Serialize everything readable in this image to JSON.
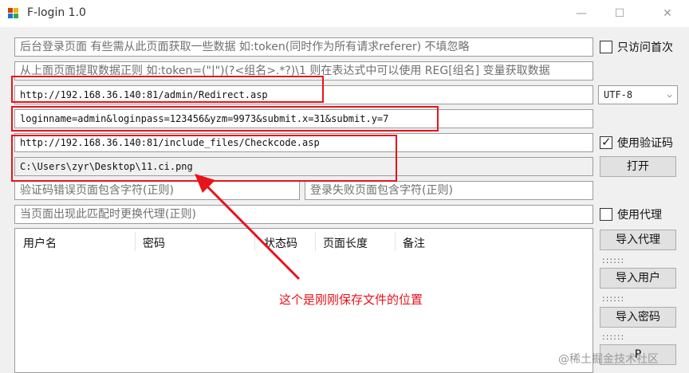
{
  "window": {
    "title": "F-login 1.0",
    "controls": {
      "minimize": "—",
      "maximize": "☐",
      "close": "✕"
    }
  },
  "form": {
    "admin_page_placeholder": "后台登录页面 有些需从此页面获取一些数据 如:token(同时作为所有请求referer) 不填忽略",
    "regex_placeholder": "从上面页面提取数据正则 如:token=(\"|\")(?<组名>.*?)\\1 则在表达式中可以使用 REG[组名] 变量获取数据",
    "login_url": "http://192.168.36.140:81/admin/Redirect.asp",
    "post_data": "loginname=admin&loginpass=123456&yzm=9973&submit.x=31&submit.y=7",
    "captcha_url": "http://192.168.36.140:81/include_files/Checkcode.asp",
    "captcha_file_path": "C:\\Users\\zyr\\Desktop\\11.ci.png",
    "captcha_error_placeholder": "验证码错误页面包含字符(正则)",
    "login_fail_placeholder": "登录失败页面包含字符(正则)",
    "proxy_switch_placeholder": "当页面出现此匹配时更换代理(正则)"
  },
  "side": {
    "only_first_visit": {
      "label": "只访问首次",
      "checked": false
    },
    "encoding": {
      "selected": "UTF-8"
    },
    "use_captcha": {
      "label": "使用验证码",
      "checked": true
    },
    "open_button": "打开",
    "use_proxy": {
      "label": "使用代理",
      "checked": false
    },
    "import_proxy_button": "导入代理",
    "import_user_button": "导入用户",
    "import_password_button": "导入密码",
    "dots": "::::::",
    "partial_button": "P"
  },
  "table": {
    "columns": [
      "用户名",
      "密码",
      "状态码",
      "页面长度",
      "备注"
    ],
    "rows": []
  },
  "annotation": {
    "text": "这个是刚刚保存文件的位置"
  },
  "watermark": "@稀土掘金技术社区",
  "colors": {
    "highlight_red": "#e8131c",
    "window_bg": "#f0f0f0"
  }
}
